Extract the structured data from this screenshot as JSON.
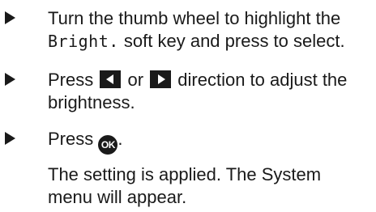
{
  "steps": [
    {
      "line1": "Turn the thumb wheel to highlight the",
      "line2_code": "Bright.",
      "line2_text": " soft key and press to select."
    },
    {
      "line1_prefix": "Press ",
      "left_key_icon": "left-arrow-key-icon",
      "line1_middle": " or ",
      "right_key_icon": "right-arrow-key-icon",
      "line1_suffix": " direction to adjust the",
      "line2": "brightness."
    },
    {
      "prefix": "Press ",
      "ok_label": "OK",
      "suffix": "."
    }
  ],
  "result": {
    "line1": "The setting is applied. The System",
    "line2": "menu will appear."
  }
}
